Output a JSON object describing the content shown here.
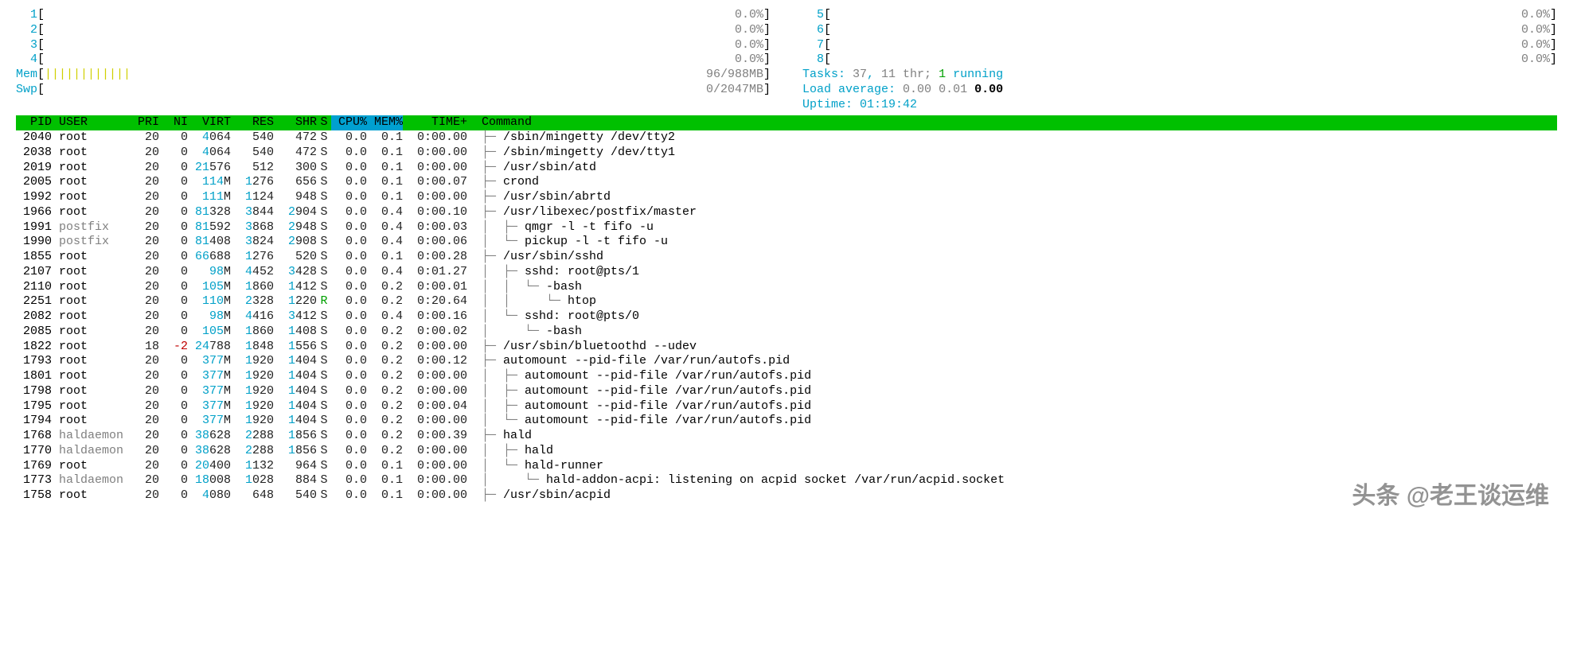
{
  "cpu_meters_left": [
    {
      "label": "1",
      "value": "0.0%"
    },
    {
      "label": "2",
      "value": "0.0%"
    },
    {
      "label": "3",
      "value": "0.0%"
    },
    {
      "label": "4",
      "value": "0.0%"
    }
  ],
  "cpu_meters_right": [
    {
      "label": "5",
      "value": "0.0%"
    },
    {
      "label": "6",
      "value": "0.0%"
    },
    {
      "label": "7",
      "value": "0.0%"
    },
    {
      "label": "8",
      "value": "0.0%"
    }
  ],
  "mem": {
    "label": "Mem",
    "fill": "||||||||||||",
    "value": "96/988MB"
  },
  "swp": {
    "label": "Swp",
    "value": "0/2047MB"
  },
  "tasks": {
    "label": "Tasks:",
    "total": "37",
    "thr": "11 thr;",
    "running": "1",
    "running_lbl": "running"
  },
  "load": {
    "label": "Load average:",
    "l1": "0.00",
    "l2": "0.01",
    "l3": "0.00"
  },
  "uptime": {
    "label": "Uptime:",
    "value": "01:19:42"
  },
  "columns": {
    "pid": "PID",
    "user": "USER",
    "pri": "PRI",
    "ni": "NI",
    "virt": "VIRT",
    "res": "RES",
    "shr": "SHR",
    "s": "S",
    "cpu": "CPU%",
    "mem": "MEM%",
    "time": "TIME+",
    "cmd": "Command"
  },
  "rows": [
    {
      "pid": "2040",
      "user": "root",
      "pri": "20",
      "ni": "0",
      "virt": "4064",
      "res": "540",
      "shr": "472",
      "s": "S",
      "cpu": "0.0",
      "mem": "0.1",
      "time": "0:00.00",
      "tree": "├─ ",
      "cmd": "/sbin/mingetty /dev/tty2"
    },
    {
      "pid": "2038",
      "user": "root",
      "pri": "20",
      "ni": "0",
      "virt": "4064",
      "res": "540",
      "shr": "472",
      "s": "S",
      "cpu": "0.0",
      "mem": "0.1",
      "time": "0:00.00",
      "tree": "├─ ",
      "cmd": "/sbin/mingetty /dev/tty1"
    },
    {
      "pid": "2019",
      "user": "root",
      "pri": "20",
      "ni": "0",
      "virt": "21576",
      "res": "512",
      "shr": "300",
      "s": "S",
      "cpu": "0.0",
      "mem": "0.1",
      "time": "0:00.00",
      "tree": "├─ ",
      "cmd": "/usr/sbin/atd"
    },
    {
      "pid": "2005",
      "user": "root",
      "pri": "20",
      "ni": "0",
      "virt": "114M",
      "res": "1276",
      "shr": "656",
      "s": "S",
      "cpu": "0.0",
      "mem": "0.1",
      "time": "0:00.07",
      "tree": "├─ ",
      "cmd": "crond"
    },
    {
      "pid": "1992",
      "user": "root",
      "pri": "20",
      "ni": "0",
      "virt": "111M",
      "res": "1124",
      "shr": "948",
      "s": "S",
      "cpu": "0.0",
      "mem": "0.1",
      "time": "0:00.00",
      "tree": "├─ ",
      "cmd": "/usr/sbin/abrtd"
    },
    {
      "pid": "1966",
      "user": "root",
      "pri": "20",
      "ni": "0",
      "virt": "81328",
      "res": "3844",
      "shr": "2904",
      "s": "S",
      "cpu": "0.0",
      "mem": "0.4",
      "time": "0:00.10",
      "tree": "├─ ",
      "cmd": "/usr/libexec/postfix/master"
    },
    {
      "pid": "1991",
      "user": "postfix",
      "pri": "20",
      "ni": "0",
      "virt": "81592",
      "res": "3868",
      "shr": "2948",
      "s": "S",
      "cpu": "0.0",
      "mem": "0.4",
      "time": "0:00.03",
      "tree": "│  ├─ ",
      "cmd": "qmgr -l -t fifo -u"
    },
    {
      "pid": "1990",
      "user": "postfix",
      "pri": "20",
      "ni": "0",
      "virt": "81408",
      "res": "3824",
      "shr": "2908",
      "s": "S",
      "cpu": "0.0",
      "mem": "0.4",
      "time": "0:00.06",
      "tree": "│  └─ ",
      "cmd": "pickup -l -t fifo -u"
    },
    {
      "pid": "1855",
      "user": "root",
      "pri": "20",
      "ni": "0",
      "virt": "66688",
      "res": "1276",
      "shr": "520",
      "s": "S",
      "cpu": "0.0",
      "mem": "0.1",
      "time": "0:00.28",
      "tree": "├─ ",
      "cmd": "/usr/sbin/sshd"
    },
    {
      "pid": "2107",
      "user": "root",
      "pri": "20",
      "ni": "0",
      "virt": "98M",
      "res": "4452",
      "shr": "3428",
      "s": "S",
      "cpu": "0.0",
      "mem": "0.4",
      "time": "0:01.27",
      "tree": "│  ├─ ",
      "cmd": "sshd: root@pts/1"
    },
    {
      "pid": "2110",
      "user": "root",
      "pri": "20",
      "ni": "0",
      "virt": "105M",
      "res": "1860",
      "shr": "1412",
      "s": "S",
      "cpu": "0.0",
      "mem": "0.2",
      "time": "0:00.01",
      "tree": "│  │  └─ ",
      "cmd": "-bash"
    },
    {
      "pid": "2251",
      "user": "root",
      "pri": "20",
      "ni": "0",
      "virt": "110M",
      "res": "2328",
      "shr": "1220",
      "s": "R",
      "cpu": "0.0",
      "mem": "0.2",
      "time": "0:20.64",
      "tree": "│  │     └─ ",
      "cmd": "htop"
    },
    {
      "pid": "2082",
      "user": "root",
      "pri": "20",
      "ni": "0",
      "virt": "98M",
      "res": "4416",
      "shr": "3412",
      "s": "S",
      "cpu": "0.0",
      "mem": "0.4",
      "time": "0:00.16",
      "tree": "│  └─ ",
      "cmd": "sshd: root@pts/0"
    },
    {
      "pid": "2085",
      "user": "root",
      "pri": "20",
      "ni": "0",
      "virt": "105M",
      "res": "1860",
      "shr": "1408",
      "s": "S",
      "cpu": "0.0",
      "mem": "0.2",
      "time": "0:00.02",
      "tree": "│     └─ ",
      "cmd": "-bash"
    },
    {
      "pid": "1822",
      "user": "root",
      "pri": "18",
      "ni": "-2",
      "virt": "24788",
      "res": "1848",
      "shr": "1556",
      "s": "S",
      "cpu": "0.0",
      "mem": "0.2",
      "time": "0:00.00",
      "tree": "├─ ",
      "cmd": "/usr/sbin/bluetoothd --udev"
    },
    {
      "pid": "1793",
      "user": "root",
      "pri": "20",
      "ni": "0",
      "virt": "377M",
      "res": "1920",
      "shr": "1404",
      "s": "S",
      "cpu": "0.0",
      "mem": "0.2",
      "time": "0:00.12",
      "tree": "├─ ",
      "cmd": "automount --pid-file /var/run/autofs.pid"
    },
    {
      "pid": "1801",
      "user": "root",
      "pri": "20",
      "ni": "0",
      "virt": "377M",
      "res": "1920",
      "shr": "1404",
      "s": "S",
      "cpu": "0.0",
      "mem": "0.2",
      "time": "0:00.00",
      "tree": "│  ├─ ",
      "cmd": "automount --pid-file /var/run/autofs.pid"
    },
    {
      "pid": "1798",
      "user": "root",
      "pri": "20",
      "ni": "0",
      "virt": "377M",
      "res": "1920",
      "shr": "1404",
      "s": "S",
      "cpu": "0.0",
      "mem": "0.2",
      "time": "0:00.00",
      "tree": "│  ├─ ",
      "cmd": "automount --pid-file /var/run/autofs.pid"
    },
    {
      "pid": "1795",
      "user": "root",
      "pri": "20",
      "ni": "0",
      "virt": "377M",
      "res": "1920",
      "shr": "1404",
      "s": "S",
      "cpu": "0.0",
      "mem": "0.2",
      "time": "0:00.04",
      "tree": "│  ├─ ",
      "cmd": "automount --pid-file /var/run/autofs.pid"
    },
    {
      "pid": "1794",
      "user": "root",
      "pri": "20",
      "ni": "0",
      "virt": "377M",
      "res": "1920",
      "shr": "1404",
      "s": "S",
      "cpu": "0.0",
      "mem": "0.2",
      "time": "0:00.00",
      "tree": "│  └─ ",
      "cmd": "automount --pid-file /var/run/autofs.pid"
    },
    {
      "pid": "1768",
      "user": "haldaemon",
      "pri": "20",
      "ni": "0",
      "virt": "38628",
      "res": "2288",
      "shr": "1856",
      "s": "S",
      "cpu": "0.0",
      "mem": "0.2",
      "time": "0:00.39",
      "tree": "├─ ",
      "cmd": "hald"
    },
    {
      "pid": "1770",
      "user": "haldaemon",
      "pri": "20",
      "ni": "0",
      "virt": "38628",
      "res": "2288",
      "shr": "1856",
      "s": "S",
      "cpu": "0.0",
      "mem": "0.2",
      "time": "0:00.00",
      "tree": "│  ├─ ",
      "cmd": "hald"
    },
    {
      "pid": "1769",
      "user": "root",
      "pri": "20",
      "ni": "0",
      "virt": "20400",
      "res": "1132",
      "shr": "964",
      "s": "S",
      "cpu": "0.0",
      "mem": "0.1",
      "time": "0:00.00",
      "tree": "│  └─ ",
      "cmd": "hald-runner"
    },
    {
      "pid": "1773",
      "user": "haldaemon",
      "pri": "20",
      "ni": "0",
      "virt": "18008",
      "res": "1028",
      "shr": "884",
      "s": "S",
      "cpu": "0.0",
      "mem": "0.1",
      "time": "0:00.00",
      "tree": "│     └─ ",
      "cmd": "hald-addon-acpi: listening on acpid socket /var/run/acpid.socket"
    },
    {
      "pid": "1758",
      "user": "root",
      "pri": "20",
      "ni": "0",
      "virt": "4080",
      "res": "648",
      "shr": "540",
      "s": "S",
      "cpu": "0.0",
      "mem": "0.1",
      "time": "0:00.00",
      "tree": "├─ ",
      "cmd": "/usr/sbin/acpid"
    }
  ],
  "watermark": "头条 @老王谈运维"
}
